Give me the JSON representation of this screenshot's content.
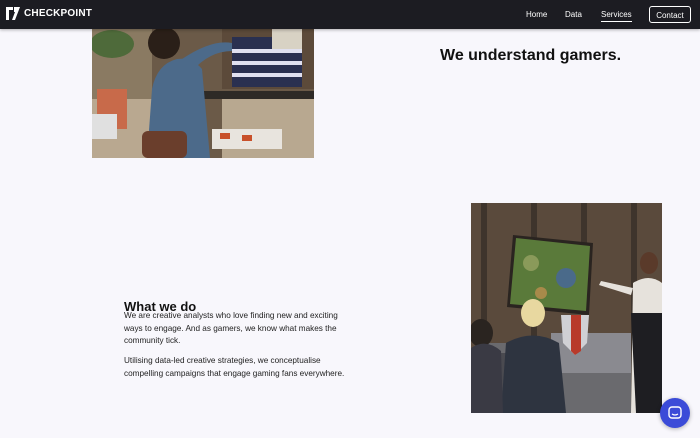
{
  "brand": {
    "name": "CHECKPOINT"
  },
  "nav": {
    "links": [
      {
        "label": "Home"
      },
      {
        "label": "Data"
      },
      {
        "label": "Services",
        "active": true
      }
    ],
    "contact_label": "Contact"
  },
  "hero": {
    "headline": "We understand gamers."
  },
  "what_we_do": {
    "title": "What we do",
    "paragraph1": "We are creative analysts who love finding new and exciting ways to engage. And as gamers, we know what makes the community tick.",
    "paragraph2": "Utilising data-led creative strategies, we conceptualise compelling campaigns that engage gaming fans everywhere."
  },
  "colors": {
    "nav_bg": "#1c1c22",
    "page_bg": "#f8f7fc",
    "chat_accent": "#3b4bd8"
  },
  "icons": {
    "logo": "checkpoint-logo-icon",
    "chat": "chat-bubble-icon"
  }
}
